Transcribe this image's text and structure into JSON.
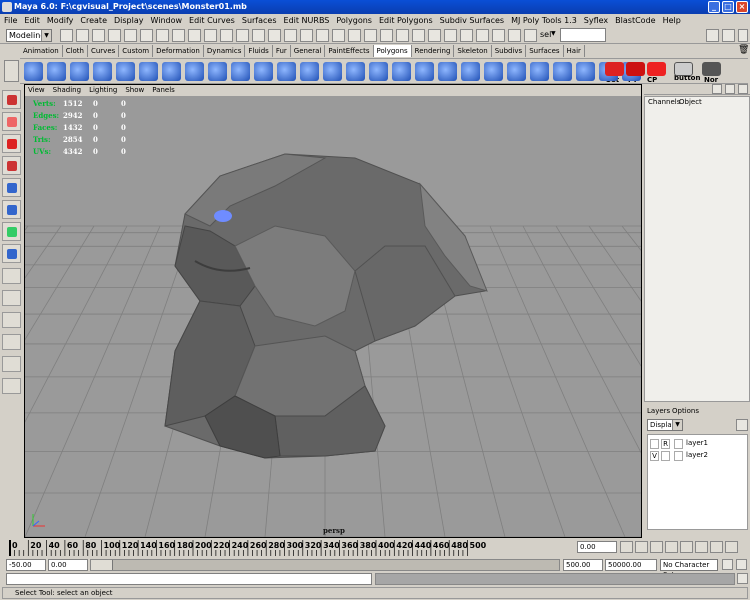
{
  "window": {
    "title": "Maya 6.0: F:\\cgvisual_Project\\scenes\\Monster01.mb"
  },
  "menubar": [
    "File",
    "Edit",
    "Modify",
    "Create",
    "Display",
    "Window",
    "Edit Curves",
    "Surfaces",
    "Edit NURBS",
    "Polygons",
    "Edit Polygons",
    "Subdiv Surfaces",
    "MJ Poly Tools 1.3",
    "Syflex",
    "BlastCode",
    "Help"
  ],
  "statusline": {
    "mode": "Modeling",
    "sel_label": "sel"
  },
  "shelf": {
    "tabs": [
      "Animation",
      "Cloth",
      "Curves",
      "Custom",
      "Deformation",
      "Dynamics",
      "Fluids",
      "Fur",
      "General",
      "PaintEffects",
      "Polygons",
      "Rendering",
      "Skeleton",
      "Subdivs",
      "Surfaces",
      "Hair"
    ],
    "active": "Polygons",
    "labels": [
      "Set",
      "FT",
      "CP",
      "mel button",
      "Nor"
    ]
  },
  "panel": {
    "menus": [
      "View",
      "Shading",
      "Lighting",
      "Show",
      "Panels"
    ],
    "camera": "persp"
  },
  "hud": [
    {
      "label": "Verts:",
      "a": "1512",
      "b": "0",
      "c": "0"
    },
    {
      "label": "Edges:",
      "a": "2942",
      "b": "0",
      "c": "0"
    },
    {
      "label": "Faces:",
      "a": "1432",
      "b": "0",
      "c": "0"
    },
    {
      "label": "Tris:",
      "a": "2854",
      "b": "0",
      "c": "0"
    },
    {
      "label": "UVs:",
      "a": "4342",
      "b": "0",
      "c": "0"
    }
  ],
  "channelbox": {
    "tabs": [
      "Channels",
      "Object"
    ]
  },
  "layers": {
    "tabs": [
      "Layers",
      "Options"
    ],
    "mode": "Display",
    "items": [
      {
        "vis": "",
        "type": "R",
        "name": "layer1"
      },
      {
        "vis": "V",
        "type": "",
        "name": "layer2"
      }
    ]
  },
  "timeline": {
    "ticks": [
      "0",
      "20",
      "40",
      "60",
      "80",
      "100",
      "120",
      "140",
      "160",
      "180",
      "200",
      "220",
      "240",
      "260",
      "280",
      "300",
      "320",
      "340",
      "360",
      "380",
      "400",
      "420",
      "440",
      "460",
      "480",
      "500"
    ],
    "current": "0.00"
  },
  "range": {
    "start": "-50.00",
    "current_start": "0.00",
    "end": "500.00",
    "anim_end": "50000.00",
    "character": "No Character Set"
  },
  "help": {
    "text": "Select Tool: select an object"
  },
  "colors": {
    "titlebar": "#0a3db0",
    "viewport_bg": "#9a9a9a",
    "ui": "#d4d0c8"
  }
}
